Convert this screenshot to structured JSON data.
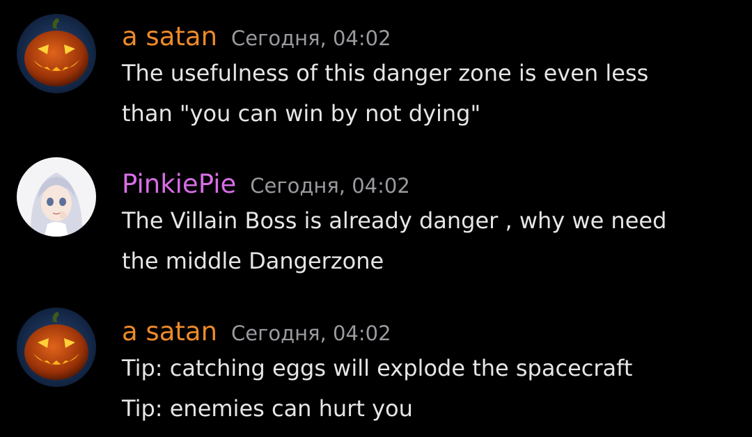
{
  "messages": [
    {
      "author": "a satan",
      "author_color": "#ee8a2a",
      "avatar_icon": "jack-o-lantern-avatar",
      "timestamp": "Сегодня, 04:02",
      "lines": [
        "The usefulness of this danger zone is even less",
        "than \"you can win by not dying\""
      ]
    },
    {
      "author": "PinkiePie",
      "author_color": "#d86ee6",
      "avatar_icon": "anime-girl-avatar",
      "timestamp": "Сегодня, 04:02",
      "lines": [
        "The Villain Boss is already danger , why we need",
        "the middle Dangerzone"
      ]
    },
    {
      "author": "a satan",
      "author_color": "#ee8a2a",
      "avatar_icon": "jack-o-lantern-avatar",
      "timestamp": "Сегодня, 04:02",
      "lines": [
        "Tip: catching eggs will explode the spacecraft",
        "Tip: enemies can hurt you"
      ]
    }
  ]
}
